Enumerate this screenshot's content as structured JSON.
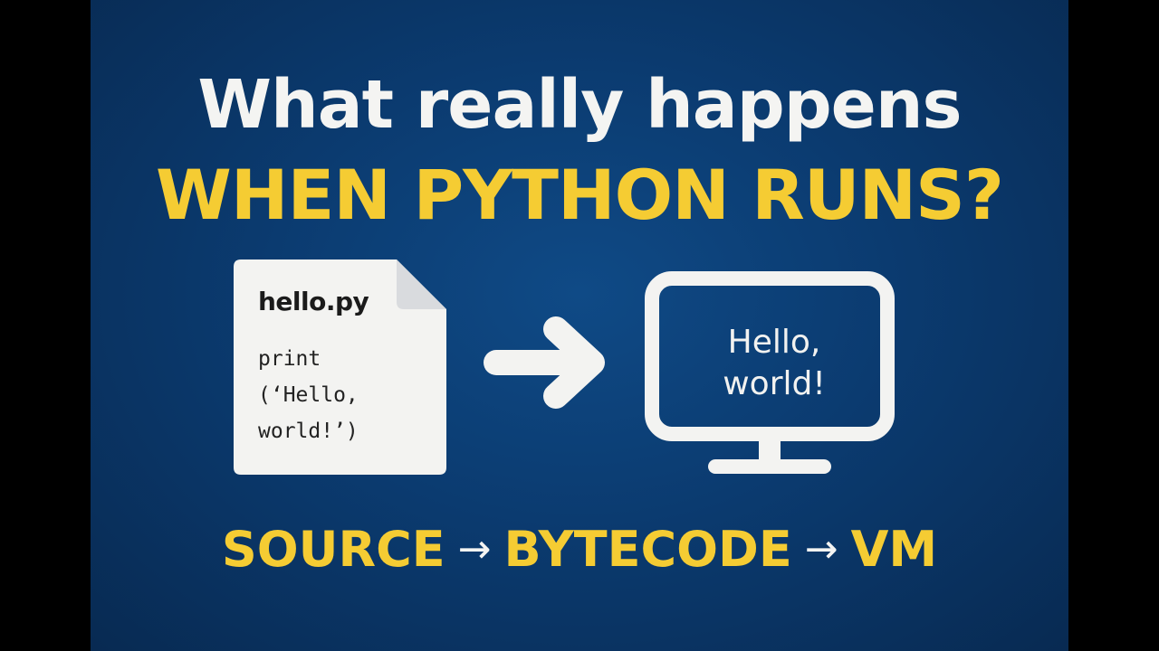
{
  "title": {
    "line1": "What really happens",
    "line2": "WHEN PYTHON RUNS?"
  },
  "file": {
    "name": "hello.py",
    "code": "print\n(‘Hello,\nworld!’)"
  },
  "screen": {
    "output": "Hello,\nworld!"
  },
  "pipeline": {
    "steps": [
      "SOURCE",
      "BYTECODE",
      "VM"
    ],
    "separator": "→"
  },
  "colors": {
    "background": "#0b3b70",
    "accent": "#f5cc33",
    "text": "#f4f4f2"
  },
  "icons": {
    "file": "document-icon",
    "arrow": "arrow-right-icon",
    "monitor": "monitor-icon"
  }
}
